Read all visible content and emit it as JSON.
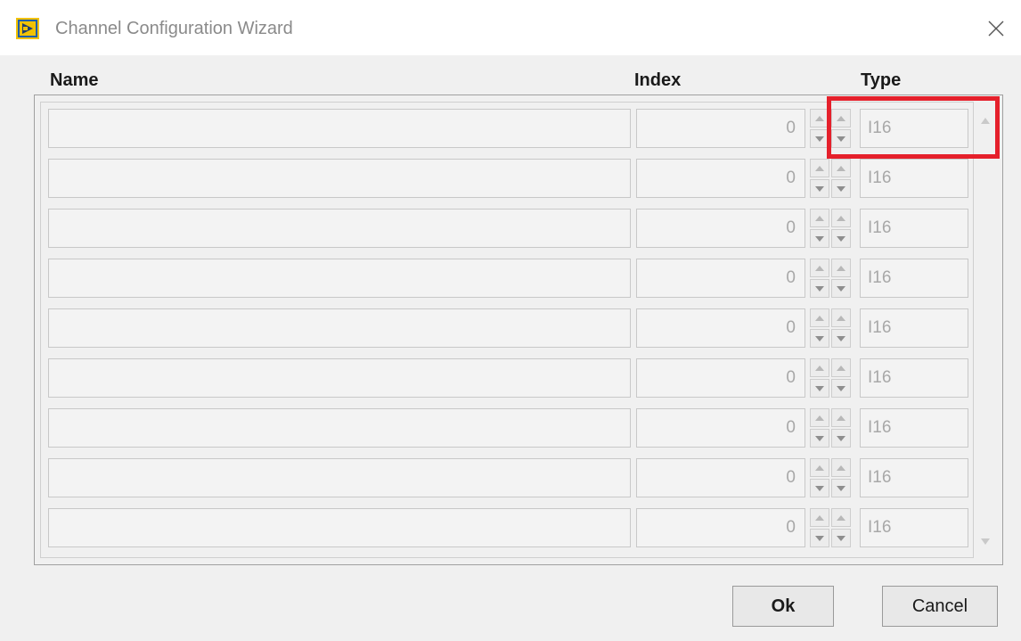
{
  "window": {
    "title": "Channel Configuration Wizard",
    "close_icon": "close-icon",
    "app_icon": "labview-app-icon"
  },
  "columns": {
    "name": "Name",
    "index": "Index",
    "type": "Type"
  },
  "rows": [
    {
      "name": "",
      "index": "0",
      "type": "I16"
    },
    {
      "name": "",
      "index": "0",
      "type": "I16"
    },
    {
      "name": "",
      "index": "0",
      "type": "I16"
    },
    {
      "name": "",
      "index": "0",
      "type": "I16"
    },
    {
      "name": "",
      "index": "0",
      "type": "I16"
    },
    {
      "name": "",
      "index": "0",
      "type": "I16"
    },
    {
      "name": "",
      "index": "0",
      "type": "I16"
    },
    {
      "name": "",
      "index": "0",
      "type": "I16"
    },
    {
      "name": "",
      "index": "0",
      "type": "I16"
    }
  ],
  "buttons": {
    "ok": "Ok",
    "cancel": "Cancel"
  },
  "colors": {
    "highlight": "#e5202b",
    "content_bg": "#f0f0f0",
    "disabled_text": "#a8a8a8"
  }
}
